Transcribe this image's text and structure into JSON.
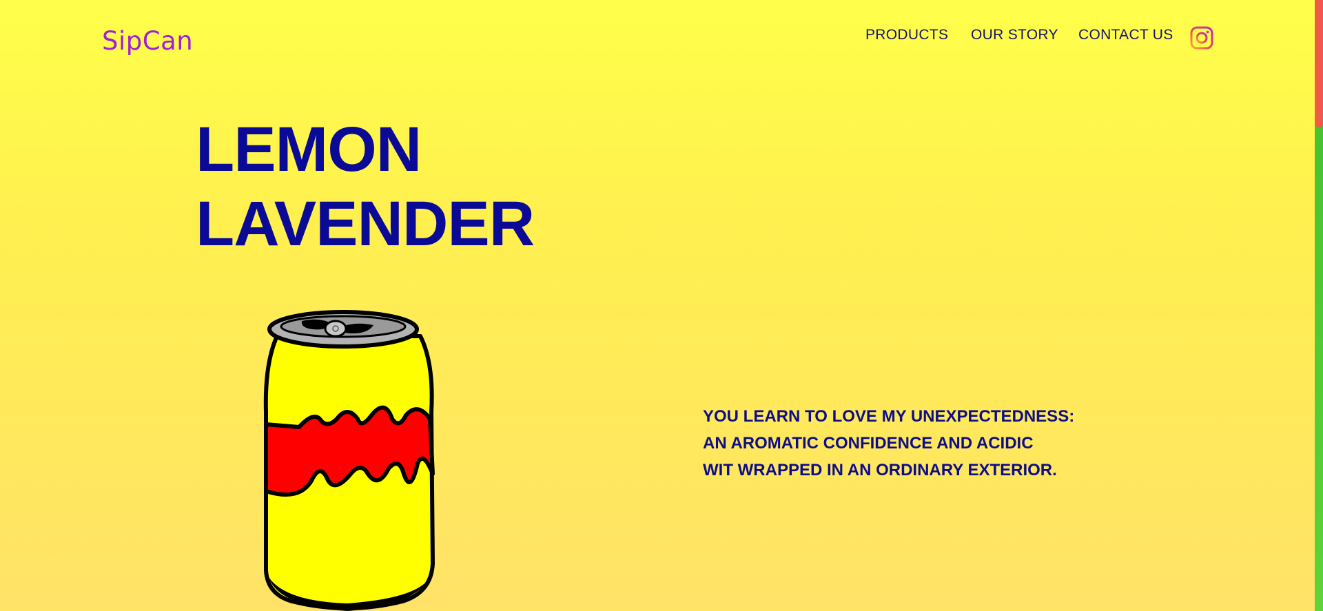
{
  "brand": {
    "name": "SipCan",
    "color": "#a21ed8"
  },
  "nav": {
    "items": [
      {
        "label": "PRODUCTS"
      },
      {
        "label": "OUR STORY"
      },
      {
        "label": "CONTACT US"
      }
    ],
    "social_icon": "instagram-icon"
  },
  "hero": {
    "title_line1": "LEMON",
    "title_line2": "LAVENDER",
    "title_color": "#0a0a96",
    "product_image": "soda-can-illustration",
    "tagline_lines": [
      "YOU LEARN TO LOVE MY UNEXPECTEDNESS:",
      "AN AROMATIC CONFIDENCE AND ACIDIC",
      "WIT WRAPPED IN AN ORDINARY EXTERIOR."
    ]
  },
  "colors": {
    "background_top": "#ffff4a",
    "background_bottom": "#ffe268",
    "nav_text": "#14116b",
    "scrollbar_track": "#3fbf2c",
    "scrollbar_thumb": "#f05a4a"
  }
}
